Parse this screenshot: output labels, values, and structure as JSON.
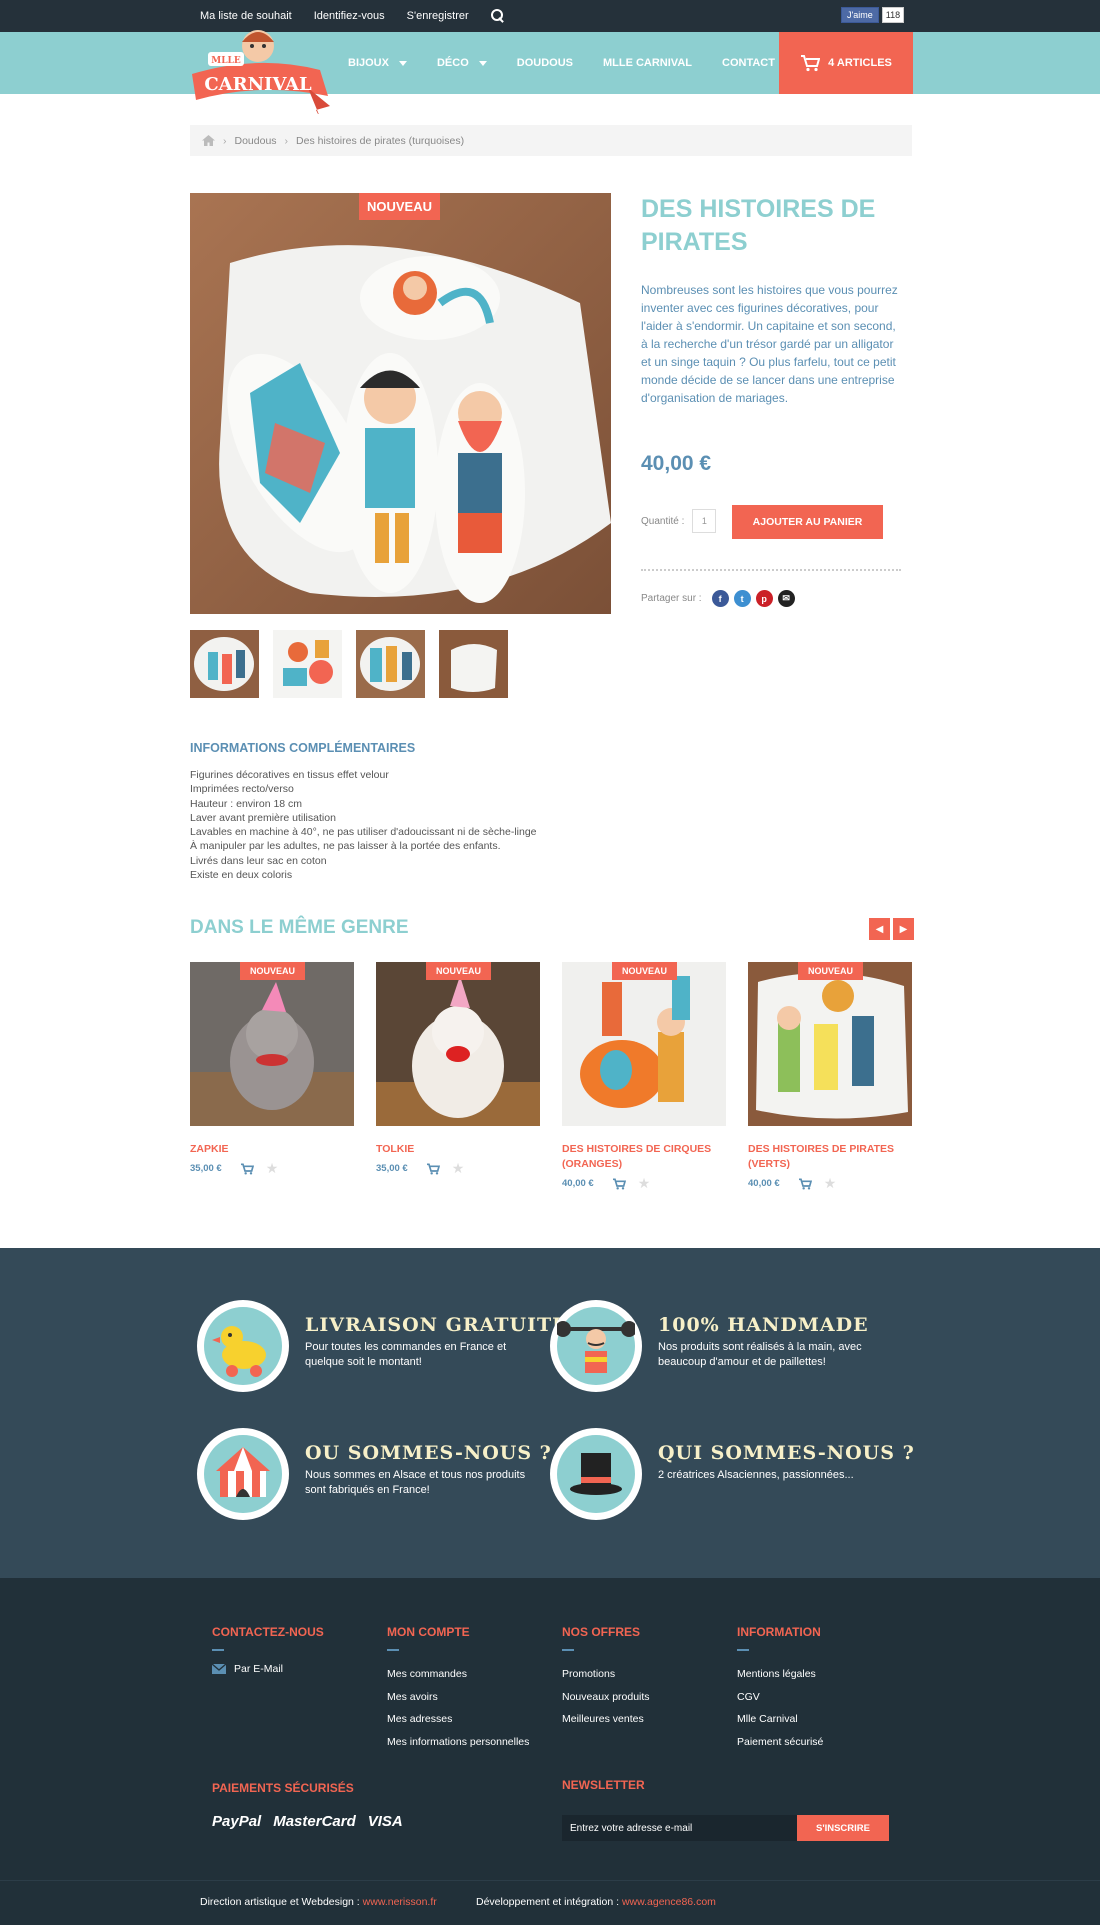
{
  "topbar": {
    "links": [
      "Ma liste de souhait",
      "Identifiez-vous",
      "S'enregistrer"
    ],
    "fb_like": "J'aime",
    "fb_count": "118"
  },
  "header": {
    "logo_text": "MLLE CARNIVAL",
    "nav": [
      "BIJOUX",
      "DÉCO",
      "DOUDOUS",
      "MLLE CARNIVAL",
      "CONTACT"
    ],
    "cart": "4 ARTICLES"
  },
  "breadcrumb": [
    "Doudous",
    "Des histoires de pirates (turquoises)"
  ],
  "product": {
    "badge": "NOUVEAU",
    "title": "DES HISTOIRES DE PIRATES",
    "description": "Nombreuses sont les histoires que vous pourrez inventer avec ces figurines décoratives, pour l'aider à s'endormir. Un capitaine et son second, à la recherche d'un trésor gardé par un alligator et un singe taquin ? Ou plus farfelu, tout ce petit monde décide de se lancer dans une entreprise d'organisation de mariages.",
    "price": "40,00 €",
    "qty_label": "Quantité :",
    "qty_value": "1",
    "add_button": "AJOUTER AU PANIER",
    "share_label": "Partager sur :"
  },
  "info": {
    "title": "INFORMATIONS COMPLÉMENTAIRES",
    "lines": [
      "Figurines décoratives en tissus effet velour",
      "Imprimées recto/verso",
      "Hauteur : environ 18 cm",
      "Laver avant première utilisation",
      "Lavables en machine à 40°, ne pas utiliser d'adoucissant ni de sèche-linge",
      "À manipuler par les adultes, ne pas laisser à la portée des enfants.",
      "Livrés dans leur sac en coton",
      "Existe en deux coloris"
    ]
  },
  "similar": {
    "title": "DANS LE MÊME GENRE",
    "products": [
      {
        "badge": "NOUVEAU",
        "name": "ZAPKIE",
        "price": "35,00 €"
      },
      {
        "badge": "NOUVEAU",
        "name": "TOLKIE",
        "price": "35,00 €"
      },
      {
        "badge": "NOUVEAU",
        "name": "DES HISTOIRES DE CIRQUES (ORANGES)",
        "price": "40,00 €"
      },
      {
        "badge": "NOUVEAU",
        "name": "DES HISTOIRES DE PIRATES (VERTS)",
        "price": "40,00 €"
      }
    ]
  },
  "features": [
    {
      "title": "LIVRAISON GRATUITE",
      "desc": "Pour toutes les commandes en France et quelque soit le montant!"
    },
    {
      "title": "100% HANDMADE",
      "desc": "Nos produits sont réalisés à la main, avec beaucoup d'amour et de paillettes!"
    },
    {
      "title": "OU SOMMES-NOUS ?",
      "desc": "Nous sommes en Alsace et tous nos produits sont fabriqués en France!"
    },
    {
      "title": "QUI SOMMES-NOUS ?",
      "desc": "2 créatrices Alsaciennes, passionnées..."
    }
  ],
  "footer": {
    "contact": {
      "title": "CONTACTEZ-NOUS",
      "email": "Par E-Mail"
    },
    "account": {
      "title": "MON COMPTE",
      "links": [
        "Mes commandes",
        "Mes avoirs",
        "Mes adresses",
        "Mes informations personnelles"
      ]
    },
    "offers": {
      "title": "NOS OFFRES",
      "links": [
        "Promotions",
        "Nouveaux produits",
        "Meilleures ventes"
      ]
    },
    "information": {
      "title": "INFORMATION",
      "links": [
        "Mentions légales",
        "CGV",
        "Mlle Carnival",
        "Paiement sécurisé"
      ]
    },
    "payments": {
      "title": "PAIEMENTS SÉCURISÉS",
      "logos": [
        "PayPal",
        "MasterCard",
        "VISA"
      ]
    },
    "newsletter": {
      "title": "NEWSLETTER",
      "placeholder": "Entrez votre adresse e-mail",
      "button": "S'INSCRIRE"
    },
    "credits": {
      "design_label": "Direction artistique et Webdesign :",
      "design_link": "www.nerisson.fr",
      "dev_label": "Développement et intégration :",
      "dev_link": "www.agence86.com"
    }
  },
  "colors": {
    "accent": "#f26552",
    "turquoise": "#8dcfd0",
    "blue": "#5b8fb3",
    "dark": "#25313a"
  }
}
